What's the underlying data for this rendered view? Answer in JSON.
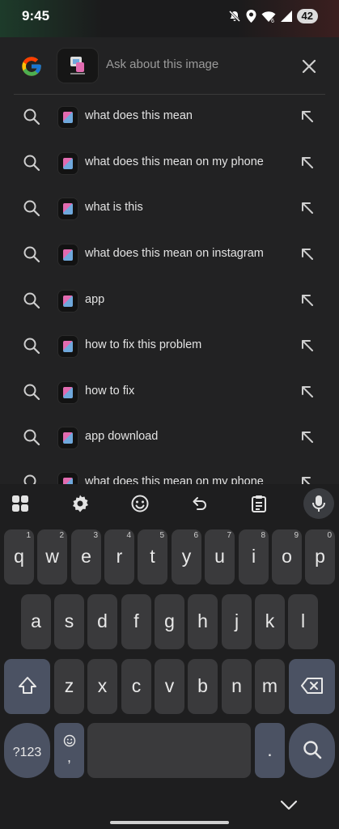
{
  "status_bar": {
    "time": "9:45",
    "battery": "42"
  },
  "search": {
    "placeholder": "Ask about this image"
  },
  "suggestions": [
    {
      "text": "what does this mean"
    },
    {
      "text": "what does this mean on my phone"
    },
    {
      "text": "what is this"
    },
    {
      "text": "what does this mean on instagram"
    },
    {
      "text": "app"
    },
    {
      "text": "how to fix this problem"
    },
    {
      "text": "how to fix"
    },
    {
      "text": "app download"
    },
    {
      "text": "what does this mean on my phone"
    }
  ],
  "keyboard": {
    "row1": [
      {
        "key": "q",
        "hint": "1"
      },
      {
        "key": "w",
        "hint": "2"
      },
      {
        "key": "e",
        "hint": "3"
      },
      {
        "key": "r",
        "hint": "4"
      },
      {
        "key": "t",
        "hint": "5"
      },
      {
        "key": "y",
        "hint": "6"
      },
      {
        "key": "u",
        "hint": "7"
      },
      {
        "key": "i",
        "hint": "8"
      },
      {
        "key": "o",
        "hint": "9"
      },
      {
        "key": "p",
        "hint": "0"
      }
    ],
    "row2": [
      "a",
      "s",
      "d",
      "f",
      "g",
      "h",
      "j",
      "k",
      "l"
    ],
    "row3": [
      "z",
      "x",
      "c",
      "v",
      "b",
      "n",
      "m"
    ],
    "symbols_label": "?123",
    "comma_label": ",",
    "period_label": "."
  },
  "colors": {
    "background": "#222223",
    "key": "#3a3a3c",
    "function_key": "#4b5263"
  }
}
